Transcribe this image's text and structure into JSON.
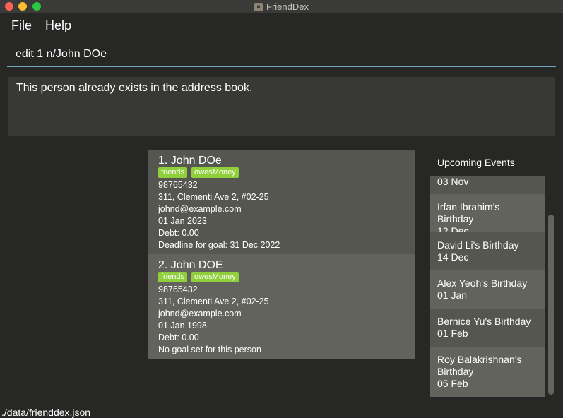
{
  "window": {
    "title": "FriendDex",
    "app_icon": "friend-dex-icon"
  },
  "menu": {
    "items": [
      "File",
      "Help"
    ]
  },
  "command_box": {
    "value": "edit 1 n/John DOe"
  },
  "result_display": {
    "text": "This person already exists in the address book."
  },
  "persons": [
    {
      "index_name": "1.  John DOe",
      "tags": [
        "friends",
        "owesMoney"
      ],
      "phone": "98765432",
      "address": "311, Clementi Ave 2, #02-25",
      "email": "johnd@example.com",
      "birthday": "01 Jan 2023",
      "debt": "Debt: 0.00",
      "goal": "Deadline for goal: 31 Dec 2022"
    },
    {
      "index_name": "2.  John DOE",
      "tags": [
        "friends",
        "owesMoney"
      ],
      "phone": "98765432",
      "address": "311, Clementi Ave 2, #02-25",
      "email": "johnd@example.com",
      "birthday": "01 Jan 1998",
      "debt": "Debt: 0.00",
      "goal": "No goal set for this person"
    }
  ],
  "events": {
    "title": "Upcoming Events",
    "items": [
      {
        "name": "",
        "date": "03 Nov"
      },
      {
        "name": "Irfan Ibrahim's Birthday",
        "date": "12 Dec"
      },
      {
        "name": "David Li's Birthday",
        "date": "14 Dec"
      },
      {
        "name": "Alex Yeoh's Birthday",
        "date": "01 Jan"
      },
      {
        "name": "Bernice Yu's Birthday",
        "date": "01 Feb"
      },
      {
        "name": "Roy Balakrishnan's Birthday",
        "date": "05 Feb"
      }
    ]
  },
  "status_bar": {
    "path": "./data/frienddex.json"
  },
  "colors": {
    "background": "#272725",
    "card_dark": "#565651",
    "card_light": "#63635e",
    "tag": "#8fcf3c",
    "accent_line": "#6fa8bd"
  }
}
